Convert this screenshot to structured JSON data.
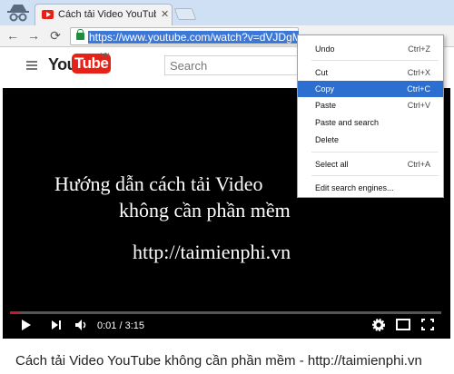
{
  "browser": {
    "tab": {
      "title": "Cách tải Video YouTube k",
      "close": "✕"
    },
    "toolbar": {
      "back": "←",
      "forward": "→",
      "reload": "⟳"
    },
    "address_bar": {
      "url": "https://www.youtube.com/watch?v=dVJDgMmOvvY",
      "selected": true
    }
  },
  "youtube": {
    "logo": {
      "you": "You",
      "tube": "Tube",
      "region": "VN"
    },
    "search": {
      "placeholder": "Search"
    }
  },
  "video": {
    "lines": [
      "Hướng dẫn cách tải Video",
      "không cần phần mềm",
      "http://taimienphi.vn"
    ],
    "time": "0:01 / 3:15",
    "progress": 0.005,
    "title": "Cách tải Video YouTube không cần phần mềm - http://taimienphi.vn"
  },
  "context_menu": {
    "items": [
      {
        "label": "Undo",
        "shortcut": "Ctrl+Z"
      },
      {
        "label": "Cut",
        "shortcut": "Ctrl+X"
      },
      {
        "label": "Copy",
        "shortcut": "Ctrl+C",
        "highlighted": true
      },
      {
        "label": "Paste",
        "shortcut": "Ctrl+V"
      },
      {
        "label": "Paste and search",
        "shortcut": ""
      },
      {
        "label": "Delete",
        "shortcut": ""
      },
      {
        "label": "Select all",
        "shortcut": "Ctrl+A"
      },
      {
        "label": "Edit search engines...",
        "shortcut": ""
      }
    ]
  },
  "colors": {
    "highlight": "#2c6fd1",
    "youtube_red": "#e62117",
    "titlebar": "#cfe0f5"
  }
}
